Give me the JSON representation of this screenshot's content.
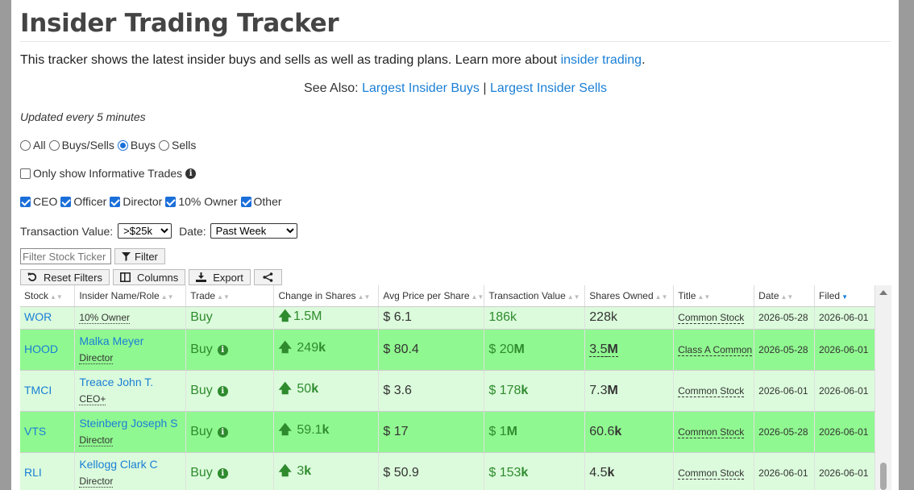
{
  "page_title": "Insider Trading Tracker",
  "intro_text": "This tracker shows the latest insider buys and sells as well as trading plans. Learn more about",
  "intro_link": "insider trading",
  "intro_end": ".",
  "see_also": {
    "label": "See Also:",
    "link1": "Largest Insider Buys",
    "sep": "|",
    "link2": "Largest Insider Sells"
  },
  "updated": "Updated every 5 minutes",
  "trade_filter": {
    "options": [
      "All",
      "Buys/Sells",
      "Buys",
      "Sells"
    ],
    "selected": "Buys"
  },
  "informative": {
    "label": "Only show Informative Trades",
    "checked": false
  },
  "roles": [
    "CEO",
    "Officer",
    "Director",
    "10% Owner",
    "Other"
  ],
  "transaction_value": {
    "label": "Transaction Value:",
    "value": ">$25k"
  },
  "date_filter": {
    "label": "Date:",
    "value": "Past Week"
  },
  "ticker_filter": {
    "placeholder": "Filter Stock Ticker",
    "button": "Filter"
  },
  "buttons": {
    "reset": "Reset Filters",
    "columns": "Columns",
    "export": "Export"
  },
  "columns": [
    "Stock",
    "Insider Name/Role",
    "Trade",
    "Change in Shares",
    "Avg Price per Share",
    "Transaction Value",
    "Shares Owned",
    "Title",
    "Date",
    "Filed"
  ],
  "partial_row": {
    "ticker": "WOR",
    "role": "10% Owner",
    "trade": "Buy",
    "change": "1.5M",
    "price": "$ 6.1",
    "value": "186k",
    "owned": "228k",
    "title": "Common Stock",
    "date": "2026-05-28",
    "filed": "2026-06-01"
  },
  "rows": [
    {
      "ticker": "HOOD",
      "name": "Malka Meyer",
      "role": "Director",
      "trade": "Buy",
      "change_num": "249",
      "change_unit": "k",
      "price": "$ 80.4",
      "value_num": "$ 20",
      "value_unit": "M",
      "owned_num": "3.5",
      "owned_unit": "M",
      "title": "Class A Common",
      "date": "2026-05-28",
      "filed": "2026-06-01"
    },
    {
      "ticker": "TMCI",
      "name": "Treace John T.",
      "role": "CEO+",
      "trade": "Buy",
      "change_num": "50",
      "change_unit": "k",
      "price": "$ 3.6",
      "value_num": "$ 178",
      "value_unit": "k",
      "owned_num": "7.3",
      "owned_unit": "M",
      "title": "Common Stock",
      "date": "2026-06-01",
      "filed": "2026-06-01"
    },
    {
      "ticker": "VTS",
      "name": "Steinberg Joseph S",
      "role": "Director",
      "trade": "Buy",
      "change_num": "59.1",
      "change_unit": "k",
      "price": "$ 17",
      "value_num": "$ 1",
      "value_unit": "M",
      "owned_num": "60.6",
      "owned_unit": "k",
      "title": "Common Stock",
      "date": "2026-05-28",
      "filed": "2026-06-01"
    },
    {
      "ticker": "RLI",
      "name": "Kellogg Clark C",
      "role": "Director",
      "trade": "Buy",
      "change_num": "3",
      "change_unit": "k",
      "price": "$ 50.9",
      "value_num": "$ 153",
      "value_unit": "k",
      "owned_num": "4.5",
      "owned_unit": "k",
      "title": "Common Stock",
      "date": "2026-06-01",
      "filed": "2026-06-01"
    }
  ]
}
